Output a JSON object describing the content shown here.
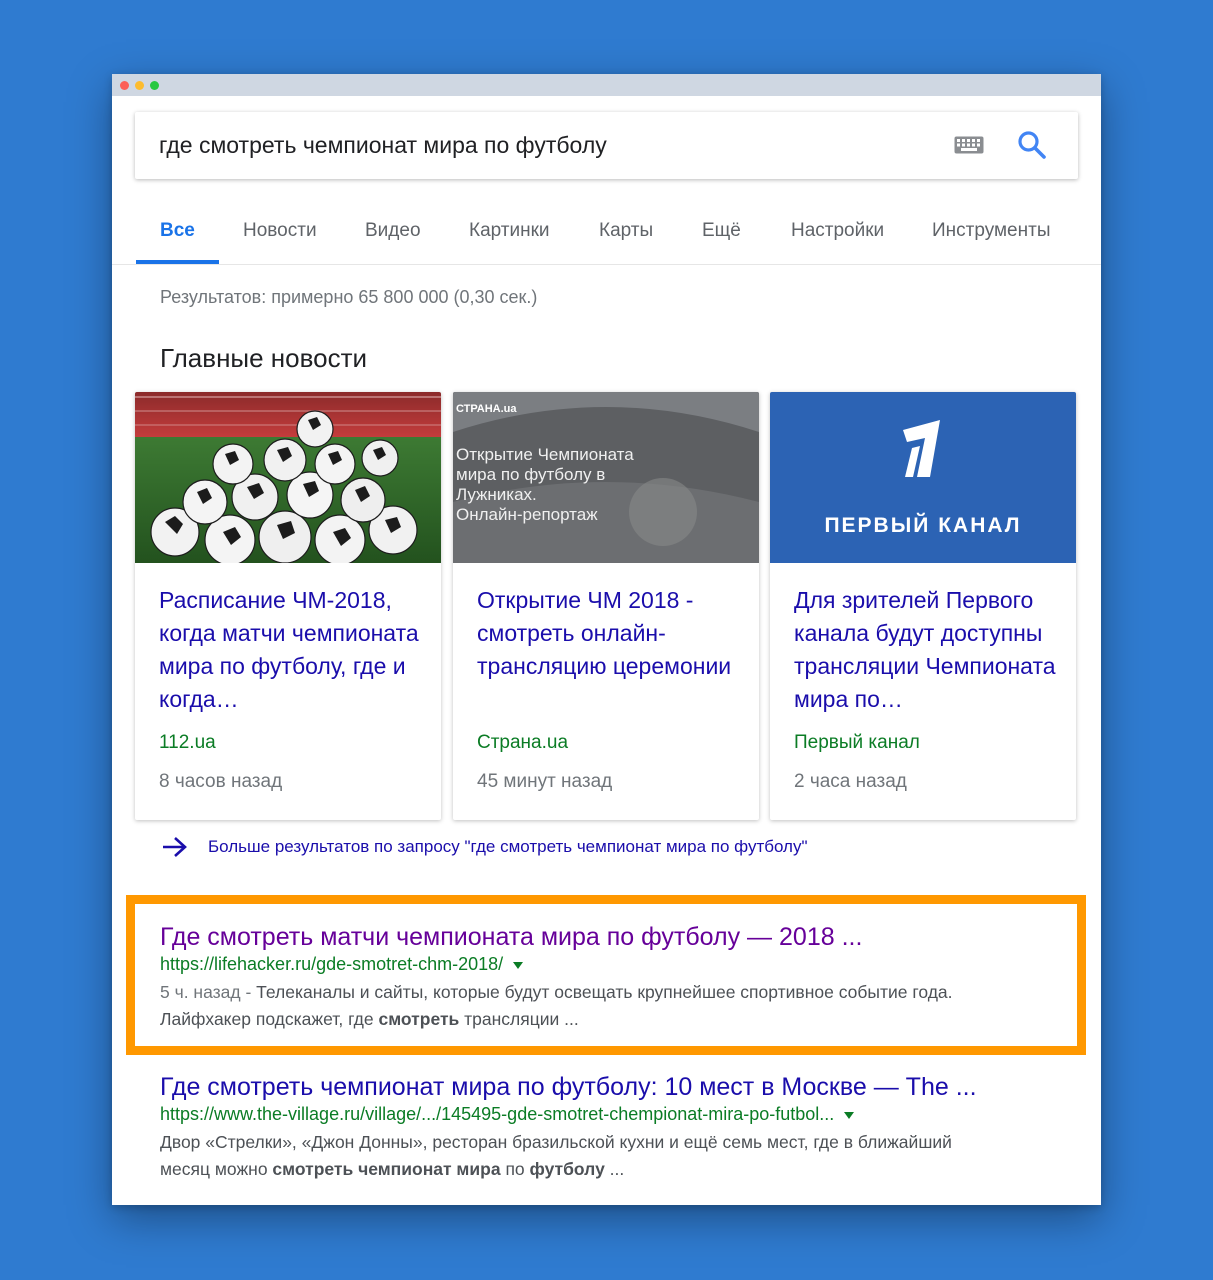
{
  "search": {
    "query": "где смотреть чемпионат мира по футболу"
  },
  "icons": {
    "keyboard": "keyboard-icon",
    "search": "search-icon",
    "more_arrow": "arrow-right-icon",
    "url_menu": "caret-down-icon"
  },
  "colors": {
    "accent": "#1a73e8",
    "link": "#1a0dab",
    "visited": "#660099",
    "url_green": "#0b7c25",
    "highlight": "#ff9800",
    "background": "#2f7bd0"
  },
  "tabs": [
    {
      "label": "Все",
      "active": true
    },
    {
      "label": "Новости"
    },
    {
      "label": "Видео"
    },
    {
      "label": "Картинки"
    },
    {
      "label": "Карты"
    },
    {
      "label": "Ещё"
    },
    {
      "label": "Настройки"
    },
    {
      "label": "Инструменты"
    }
  ],
  "stats": "Результатов: примерно 65 800 000 (0,30 сек.)",
  "top_news": {
    "title": "Главные новости",
    "cards": [
      {
        "headline": "Расписание ЧМ-2018, когда матчи чемпионата мира по футболу, где и когда…",
        "source": "112.ua",
        "time": "8 часов назад"
      },
      {
        "headline": "Открытие ЧМ 2018 - смотреть онлайн-трансляцию церемонии",
        "source": "Страна.ua",
        "time": "45 минут назад",
        "thumb_brand": "СТРАНА.ua",
        "thumb_lines": [
          "Открытие Чемпионата",
          "мира по футболу в",
          "Лужниках.",
          "Онлайн-репортаж"
        ]
      },
      {
        "headline": "Для зрителей Первого канала будут доступны трансляции Чемпионата мира по…",
        "source": "Первый канал",
        "time": "2 часа назад",
        "thumb_text": "ПЕРВЫЙ КАНАЛ"
      }
    ],
    "more": "Больше результатов по запросу \"где смотреть чемпионат мира по футболу\""
  },
  "results": [
    {
      "title": "Где смотреть матчи чемпионата мира по футболу — 2018 ...",
      "url": "https://lifehacker.ru/gde-smotret-chm-2018/",
      "date": "5 ч. назад - ",
      "snippet_1": "Телеканалы и сайты, которые будут освещать крупнейшее спортивное событие года.",
      "snippet_2a": "Лайфхакер подскажет, где ",
      "snippet_2b": "смотреть",
      "snippet_2c": " трансляции ..."
    },
    {
      "title": "Где смотреть чемпионат мира по футболу: 10 мест в Москве — The ...",
      "url": "https://www.the-village.ru/village/.../145495-gde-smotret-chempionat-mira-po-futbol...",
      "snippet_1": "Двор «Стрелки», «Джон Донны», ресторан бразильской кухни и ещё семь мест, где в ближайший",
      "snippet_2a": "месяц можно ",
      "snippet_2b": "смотреть чемпионат мира",
      "snippet_2c": " по ",
      "snippet_2d": "футболу",
      "snippet_2e": " ..."
    }
  ]
}
